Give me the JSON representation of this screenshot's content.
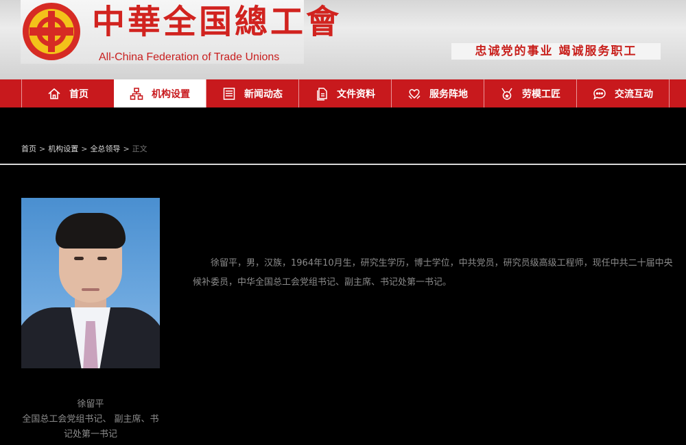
{
  "header": {
    "logo_cn": "中華全国總工會",
    "logo_en": "All-China Federation of Trade Unions",
    "slogan": "忠诚党的事业  竭诚服务职工"
  },
  "nav": {
    "items": [
      {
        "label": "首页",
        "icon": "home-icon"
      },
      {
        "label": "机构设置",
        "icon": "org-chart-icon",
        "active": true
      },
      {
        "label": "新闻动态",
        "icon": "news-icon"
      },
      {
        "label": "文件资料",
        "icon": "documents-icon"
      },
      {
        "label": "服务阵地",
        "icon": "heart-hands-icon"
      },
      {
        "label": "劳模工匠",
        "icon": "medal-icon"
      },
      {
        "label": "交流互动",
        "icon": "chat-icon"
      }
    ]
  },
  "breadcrumb": {
    "items": [
      "首页",
      "机构设置",
      "全总领导"
    ],
    "current": "正文",
    "separator": ">"
  },
  "profile": {
    "name": "徐留平",
    "title": "全国总工会党组书记、 副主席、书记处第一书记",
    "bio": "徐留平，男，汉族，1964年10月生，研究生学历，博士学位，中共党员，研究员级高级工程师，现任中共二十届中央候补委员，中华全国总工会党组书记、副主席、书记处第一书记。"
  },
  "colors": {
    "brand_red": "#c8191d",
    "background": "#000000"
  }
}
